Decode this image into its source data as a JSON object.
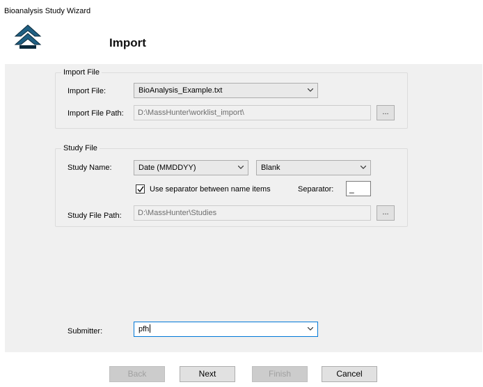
{
  "window": {
    "title": "Bioanalysis Study Wizard"
  },
  "header": {
    "icon": "double-chevron-up-icon",
    "title": "Import"
  },
  "import_group": {
    "legend": "Import File",
    "file_label": "Import File:",
    "file_value": "BioAnalysis_Example.txt",
    "path_label": "Import File Path:",
    "path_value": "D:\\MassHunter\\worklist_import\\",
    "browse_label": "..."
  },
  "study_group": {
    "legend": "Study File",
    "name_label": "Study Name:",
    "name_part1": "Date (MMDDYY)",
    "name_part2": "Blank",
    "separator_checkbox_label": "Use separator between name items",
    "separator_checked": true,
    "separator_label": "Separator:",
    "separator_value": "_",
    "path_label": "Study File Path:",
    "path_value": "D:\\MassHunter\\Studies",
    "browse_label": "..."
  },
  "submitter": {
    "label": "Submitter:",
    "value": "pfh"
  },
  "buttons": {
    "back": "Back",
    "next": "Next",
    "finish": "Finish",
    "cancel": "Cancel"
  },
  "colors": {
    "panel_bg": "#f0f0f0",
    "logo_blue": "#1f5f82",
    "focus_border": "#0078d7"
  }
}
